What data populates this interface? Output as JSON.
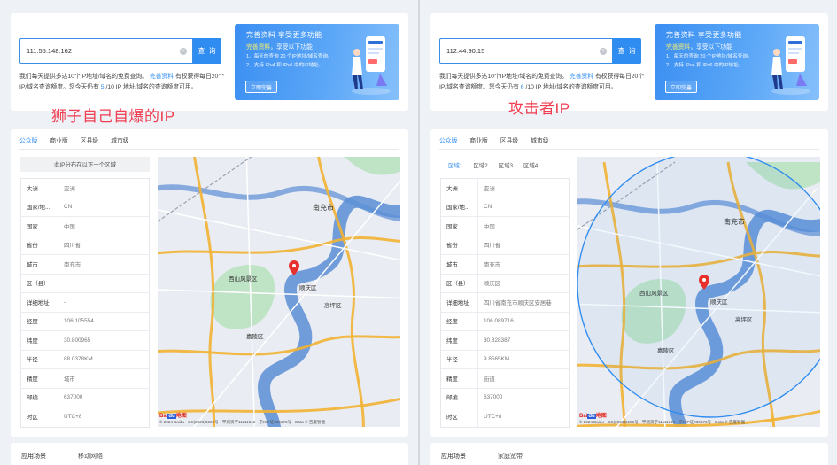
{
  "panels": [
    {
      "search": {
        "value": "111.55.148.162",
        "button": "查 询"
      },
      "desc": {
        "pre": "我们每天提供多达10个IP地址/域名的免费查询。",
        "link": "完善资料",
        "mid": "有权获得每日20个IP/域名查询额度。您今天仍有 ",
        "count": "5",
        "post": "/10 IP 地址/域名的查询额度可用。"
      },
      "promo": {
        "title": "完善资料 享受更多功能",
        "sub_hl": "完善资料",
        "sub_rest": "，享受以下功能",
        "line1": "1、每天的查询 20 个IP地址/域名查询。",
        "line2": "2、支持 IPv4 和 IPv6 中的IP地址。",
        "button": "立即完善"
      },
      "annotation": "狮子自己自爆的IP",
      "tabs": [
        "公众版",
        "商业版",
        "区县级",
        "城市级"
      ],
      "region_head": "此IP分布在以下一个区域",
      "rows": [
        {
          "k": "大洲",
          "v": "亚洲"
        },
        {
          "k": "国家/地...",
          "v": "CN"
        },
        {
          "k": "国家",
          "v": "中国"
        },
        {
          "k": "省份",
          "v": "四川省"
        },
        {
          "k": "城市",
          "v": "南充市"
        },
        {
          "k": "区（县）",
          "v": "-"
        },
        {
          "k": "详细地址",
          "v": "-"
        },
        {
          "k": "经度",
          "v": "106.105554"
        },
        {
          "k": "纬度",
          "v": "30.800965"
        },
        {
          "k": "半径",
          "v": "88.0378KM"
        },
        {
          "k": "精度",
          "v": "城市"
        },
        {
          "k": "邮编",
          "v": "637000"
        },
        {
          "k": "时区",
          "v": "UTC+8"
        }
      ],
      "map": {
        "labels": [
          "南充市",
          "顺庆区",
          "高坪区",
          "嘉陵区",
          "西山风景区"
        ],
        "footer": "© 2024 Baidu - GS(2023)3206号 - 甲测资字11111342 - 京ICP证030173号 - Data © 百度智图",
        "logo_a": "Bai",
        "logo_b": "du",
        "logo_c": "地图"
      },
      "bottom": {
        "k": "应用场景",
        "v": "移动网络"
      }
    },
    {
      "search": {
        "value": "112.44.90.15",
        "button": "查 询"
      },
      "desc": {
        "pre": "我们每天提供多达10个IP地址/域名的免费查询。",
        "link": "完善资料",
        "mid": "有权获得每日20个IP/域名查询额度。您今天仍有 ",
        "count": "6",
        "post": "/10 IP 地址/域名的查询额度可用。"
      },
      "promo": {
        "title": "完善资料 享受更多功能",
        "sub_hl": "完善资料",
        "sub_rest": "，享受以下功能",
        "line1": "1、每天的查询 20 个IP地址/域名查询。",
        "line2": "2、支持 IPv4 和 IPv6 中的IP地址。",
        "button": "立即完善"
      },
      "annotation": "攻击者IP",
      "tabs": [
        "公众版",
        "商业版",
        "区县级",
        "城市级"
      ],
      "subtabs": [
        "区域1",
        "区域2",
        "区域3",
        "区域4"
      ],
      "rows": [
        {
          "k": "大洲",
          "v": "亚洲"
        },
        {
          "k": "国家/地...",
          "v": "CN"
        },
        {
          "k": "国家",
          "v": "中国"
        },
        {
          "k": "省份",
          "v": "四川省"
        },
        {
          "k": "城市",
          "v": "南充市"
        },
        {
          "k": "区（县）",
          "v": "顺庆区"
        },
        {
          "k": "详细地址",
          "v": "四川省南充市顺庆区安居巷"
        },
        {
          "k": "经度",
          "v": "106.089716"
        },
        {
          "k": "纬度",
          "v": "30.828387"
        },
        {
          "k": "半径",
          "v": "9.8565KM"
        },
        {
          "k": "精度",
          "v": "街道"
        },
        {
          "k": "邮编",
          "v": "637000"
        },
        {
          "k": "时区",
          "v": "UTC+8"
        }
      ],
      "map": {
        "labels": [
          "南充市",
          "顺庆区",
          "高坪区",
          "嘉陵区",
          "西山风景区"
        ],
        "footer": "© 2024 Baidu - GS(2023)3206号 - 甲测资字11111342 - 京ICP证030173号 - Data © 百度智图",
        "logo_a": "Bai",
        "logo_b": "du",
        "logo_c": "地图"
      },
      "bottom": {
        "k": "应用场景",
        "v": "家庭宽带"
      }
    }
  ],
  "colors": {
    "accent": "#2f8cf0",
    "annotation": "#f03e52",
    "river": "#5b8fd6",
    "road": "#f2b233",
    "marker": "#e8312d"
  }
}
